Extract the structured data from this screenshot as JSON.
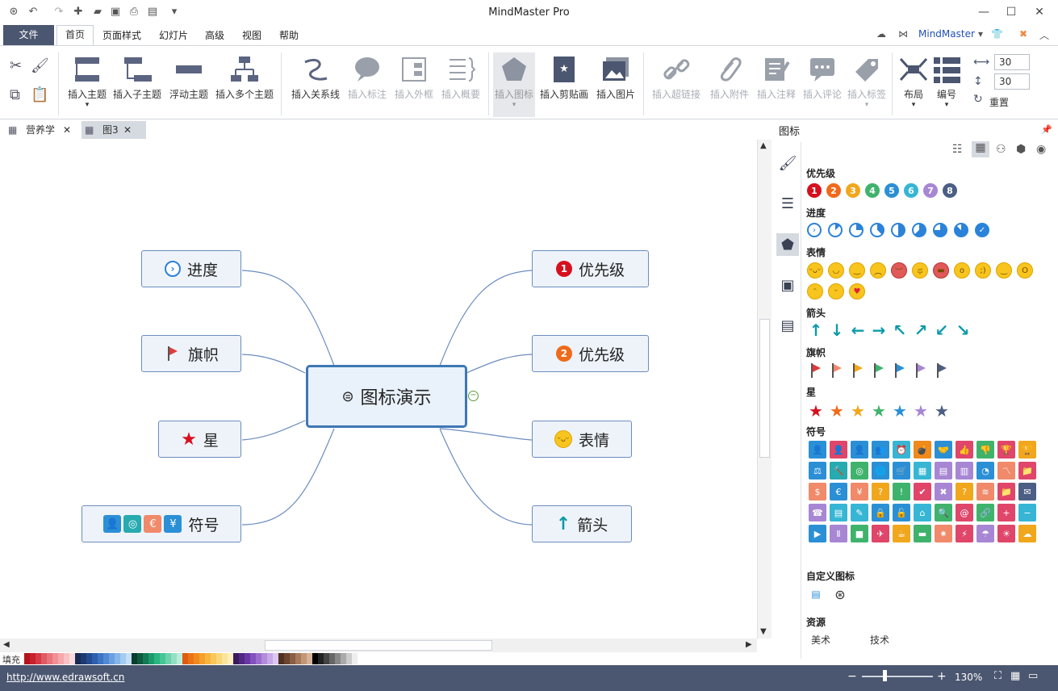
{
  "app": {
    "title": "MindMaster Pro"
  },
  "menu": {
    "file": "文件",
    "tabs": [
      "首页",
      "页面样式",
      "幻灯片",
      "高级",
      "视图",
      "帮助"
    ],
    "brand": "MindMaster"
  },
  "ribbon": {
    "buttons": [
      "插入主题",
      "插入子主题",
      "浮动主题",
      "插入多个主题",
      "插入关系线",
      "插入标注",
      "插入外框",
      "插入概要",
      "插入图标",
      "插入剪贴画",
      "插入图片",
      "插入超链接",
      "插入附件",
      "插入注释",
      "插入评论",
      "插入标签",
      "布局",
      "编号"
    ],
    "spin1": "30",
    "spin2": "30",
    "reset": "重置"
  },
  "doctabs": [
    "营养学",
    "图3"
  ],
  "canvas": {
    "central": "图标演示",
    "nodes": {
      "progress": "进度",
      "flag": "旗帜",
      "star": "星",
      "symbol": "符号",
      "p1": "优先级",
      "p2": "优先级",
      "emotion": "表情",
      "arrow": "箭头"
    },
    "badges": {
      "p1": "1",
      "p2": "2",
      "sym": [
        "👤",
        "◎",
        "€",
        "¥"
      ]
    }
  },
  "panel": {
    "title": "图标",
    "sections": {
      "priority": "优先级",
      "progress": "进度",
      "emotion": "表情",
      "arrow": "箭头",
      "flag": "旗帜",
      "star": "星",
      "symbol": "符号",
      "custom": "自定义图标",
      "resource": "资源"
    },
    "priority_nums": [
      "1",
      "2",
      "3",
      "4",
      "5",
      "6",
      "7",
      "8"
    ],
    "resource_links": [
      "美术",
      "技术"
    ]
  },
  "status": {
    "fill": "填充",
    "url": "http://www.edrawsoft.cn",
    "zoom": "130%"
  },
  "colors": {
    "accent": "#4b5670",
    "node_border": "#6b8dbf",
    "central_border": "#3e78b4",
    "priority": [
      "#d7101e",
      "#ef6a1b",
      "#f1a71d",
      "#3fb36c",
      "#2b8fd6",
      "#36b6d4",
      "#a786d4",
      "#4b5e84"
    ]
  }
}
